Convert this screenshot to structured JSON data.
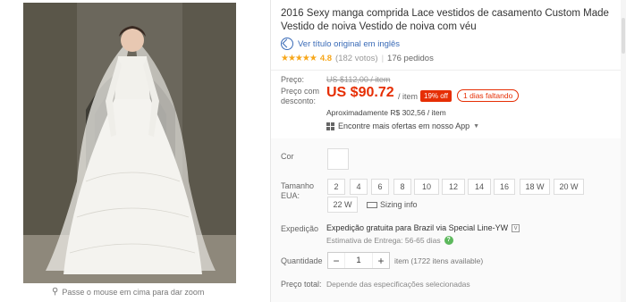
{
  "gallery": {
    "zoom_hint": "Passe o mouse em cima para dar zoom"
  },
  "product": {
    "title": "2016 Sexy manga comprida Lace vestidos de casamento Custom Made Vestido de noiva Vestido de noiva com véu",
    "translate_link": "Ver título original em inglês",
    "rating": "4.8",
    "votes": "(182 votos)",
    "orders": "176 pedidos"
  },
  "pricing": {
    "price_label": "Preço:",
    "old_price": "US $112,00 / item",
    "discount_label": "Preço com desconto:",
    "new_price": "US $90.72",
    "per_item": "/ item",
    "discount_badge": "19% off",
    "time_left": "1 dias faltando",
    "approx": "Aproximadamente R$ 302,56 / item",
    "other_offers": "Encontre mais ofertas em nosso App"
  },
  "options": {
    "color_label": "Cor",
    "size_label": "Tamanho EUA:",
    "sizes": [
      "2",
      "4",
      "6",
      "8",
      "10",
      "12",
      "14",
      "16",
      "18 W",
      "20 W",
      "22 W"
    ],
    "sizing_info": "Sizing info",
    "shipping_label": "Expedição",
    "shipping_text": "Expedição gratuita para Brazil via Special Line-YW",
    "eta": "Estimativa de Entrega: 56-65  dias",
    "quantity_label": "Quantidade",
    "quantity_value": "1",
    "quantity_available": "item (1722 itens available)",
    "total_label": "Preço total:",
    "total_hint": "Depende das especificações selecionadas"
  },
  "colors": {
    "price_red": "#e62e04",
    "star_orange": "#f7a71b",
    "link_blue": "#3a6bb7"
  }
}
